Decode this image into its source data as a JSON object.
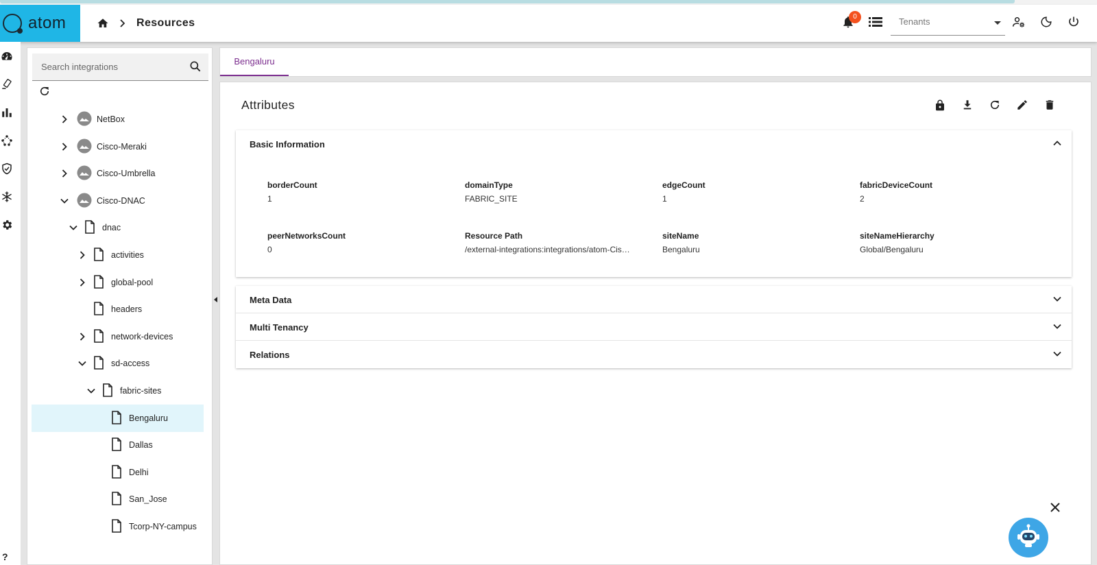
{
  "app": {
    "logo_text": "atom"
  },
  "header": {
    "breadcrumb_label": "Resources",
    "notification_count": "0",
    "tenants_placeholder": "Tenants",
    "icons": [
      "home-icon",
      "chevron-right-icon",
      "bell-icon",
      "list-icon",
      "user-settings-icon",
      "moon-icon",
      "power-icon"
    ]
  },
  "rail": {
    "icons": [
      "dashboard-icon",
      "devices-icon",
      "bar-chart-icon",
      "topology-icon",
      "shield-icon",
      "snowflake-icon",
      "gear-icon"
    ],
    "help_label": "?"
  },
  "sidebar": {
    "search_placeholder": "Search integrations",
    "tree": [
      {
        "label": "NetBox",
        "expanded": false,
        "icon": "integration-icon"
      },
      {
        "label": "Cisco-Meraki",
        "expanded": false,
        "icon": "integration-icon"
      },
      {
        "label": "Cisco-Umbrella",
        "expanded": false,
        "icon": "integration-icon"
      },
      {
        "label": "Cisco-DNAC",
        "expanded": true,
        "icon": "integration-icon"
      },
      {
        "label": "dnac",
        "expanded": true,
        "icon": "file-icon"
      },
      {
        "label": "activities",
        "expanded": false,
        "icon": "file-icon"
      },
      {
        "label": "global-pool",
        "expanded": false,
        "icon": "file-icon"
      },
      {
        "label": "headers",
        "expanded": null,
        "icon": "file-icon"
      },
      {
        "label": "network-devices",
        "expanded": false,
        "icon": "file-icon"
      },
      {
        "label": "sd-access",
        "expanded": true,
        "icon": "file-icon"
      },
      {
        "label": "fabric-sites",
        "expanded": true,
        "icon": "file-icon"
      },
      {
        "label": "Bengaluru",
        "expanded": null,
        "icon": "file-icon",
        "selected": true
      },
      {
        "label": "Dallas",
        "expanded": null,
        "icon": "file-icon"
      },
      {
        "label": "Delhi",
        "expanded": null,
        "icon": "file-icon"
      },
      {
        "label": "San_Jose",
        "expanded": null,
        "icon": "file-icon"
      },
      {
        "label": "Tcorp-NY-campus",
        "expanded": null,
        "icon": "file-icon"
      }
    ]
  },
  "tabs": [
    {
      "label": "Bengaluru",
      "active": true
    }
  ],
  "main": {
    "title": "Attributes",
    "toolbar_icons": [
      "lock-icon",
      "download-icon",
      "refresh-icon",
      "edit-icon",
      "delete-icon"
    ],
    "basic_info": {
      "title": "Basic Information",
      "attributes": [
        {
          "key": "borderCount",
          "value": "1"
        },
        {
          "key": "domainType",
          "value": "FABRIC_SITE"
        },
        {
          "key": "edgeCount",
          "value": "1"
        },
        {
          "key": "fabricDeviceCount",
          "value": "2"
        },
        {
          "key": "peerNetworksCount",
          "value": "0"
        },
        {
          "key": "Resource Path",
          "value": "/external-integrations:integrations/atom-Cisco-DNAC/dnac/sd-access/fabric-sites/Bengaluru"
        },
        {
          "key": "siteName",
          "value": "Bengaluru"
        },
        {
          "key": "siteNameHierarchy",
          "value": "Global/Bengaluru"
        }
      ]
    },
    "sections": [
      {
        "title": "Meta Data"
      },
      {
        "title": "Multi Tenancy"
      },
      {
        "title": "Relations"
      }
    ]
  },
  "colors": {
    "brand": "#1fb6e6",
    "tab_accent": "#7b2d8e",
    "badge": "#f4511e",
    "selected_row": "#e1f5fb",
    "bot": "#3ea6e6"
  }
}
